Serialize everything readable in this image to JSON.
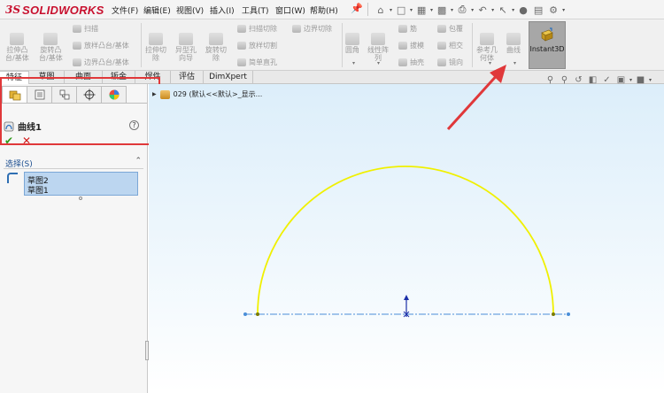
{
  "app": {
    "logo_prefix": "3S",
    "logo_text": "SOLIDWORKS"
  },
  "menu": {
    "items": [
      "文件(F)",
      "编辑(E)",
      "视图(V)",
      "插入(I)",
      "工具(T)",
      "窗口(W)",
      "帮助(H)"
    ]
  },
  "quick_access": {
    "icons": [
      "home-icon",
      "new-document-icon",
      "open-folder-icon",
      "save-icon",
      "print-icon",
      "undo-icon",
      "select-pointer-icon",
      "rebuild-icon",
      "file-properties-icon",
      "options-gear-icon"
    ]
  },
  "ribbon": {
    "tools_large": [
      {
        "label": "拉伸凸\n台/基体",
        "icon": "extrude-boss-icon"
      },
      {
        "label": "旋转凸\n台/基体",
        "icon": "revolve-boss-icon"
      },
      {
        "label": "拉伸切\n除",
        "icon": "extrude-cut-icon"
      },
      {
        "label": "异型孔\n向导",
        "icon": "hole-wizard-icon"
      },
      {
        "label": "旋转切\n除",
        "icon": "revolve-cut-icon"
      },
      {
        "label": "圆角",
        "icon": "fillet-icon"
      },
      {
        "label": "线性阵\n列",
        "icon": "linear-pattern-icon"
      },
      {
        "label": "参考几\n何体",
        "icon": "reference-geometry-icon"
      },
      {
        "label": "曲线",
        "icon": "curves-icon"
      }
    ],
    "tools_small": [
      {
        "label": "扫描",
        "icon": "sweep-icon"
      },
      {
        "label": "放样凸台/基体",
        "icon": "loft-icon"
      },
      {
        "label": "边界凸台/基体",
        "icon": "boundary-boss-icon"
      },
      {
        "label": "扫描切除",
        "icon": "swept-cut-icon"
      },
      {
        "label": "放样切割",
        "icon": "lofted-cut-icon"
      },
      {
        "label": "简单直孔",
        "icon": "simple-hole-icon"
      },
      {
        "label": "边界切除",
        "icon": "boundary-cut-icon"
      },
      {
        "label": "筋",
        "icon": "rib-icon"
      },
      {
        "label": "拔模",
        "icon": "draft-icon"
      },
      {
        "label": "抽壳",
        "icon": "shell-icon"
      },
      {
        "label": "包覆",
        "icon": "wrap-icon"
      },
      {
        "label": "相交",
        "icon": "intersect-icon"
      },
      {
        "label": "镜向",
        "icon": "mirror-icon"
      }
    ],
    "instant3d_label": "Instant3D"
  },
  "tabs": [
    "特征",
    "草图",
    "曲面",
    "钣金",
    "焊件",
    "评估",
    "DimXpert"
  ],
  "active_tab": "特征",
  "property_manager": {
    "tabs": [
      "feature-manager-icon",
      "property-manager-icon",
      "configuration-manager-icon",
      "dimxpert-manager-icon",
      "display-manager-icon"
    ],
    "title": "曲线1",
    "help": "?",
    "ok": "✔",
    "cancel": "✕",
    "section_title": "选择(S)",
    "collapse": "⌃",
    "selections": [
      "草图2",
      "草图1"
    ]
  },
  "graphics": {
    "tree_item": "029  (默认<<默认>_显示...",
    "hud_icons": [
      "zoom-to-fit-icon",
      "zoom-area-icon",
      "previous-view-icon",
      "section-view-icon",
      "dynamic-annotation-icon",
      "view-orientation-icon",
      "display-style-icon"
    ],
    "sketch_color": "#f0f000",
    "construction_color": "#4a8ed8",
    "origin_color": "#1b2fa8"
  },
  "annotation": {
    "highlight_color": "#e0383a"
  }
}
